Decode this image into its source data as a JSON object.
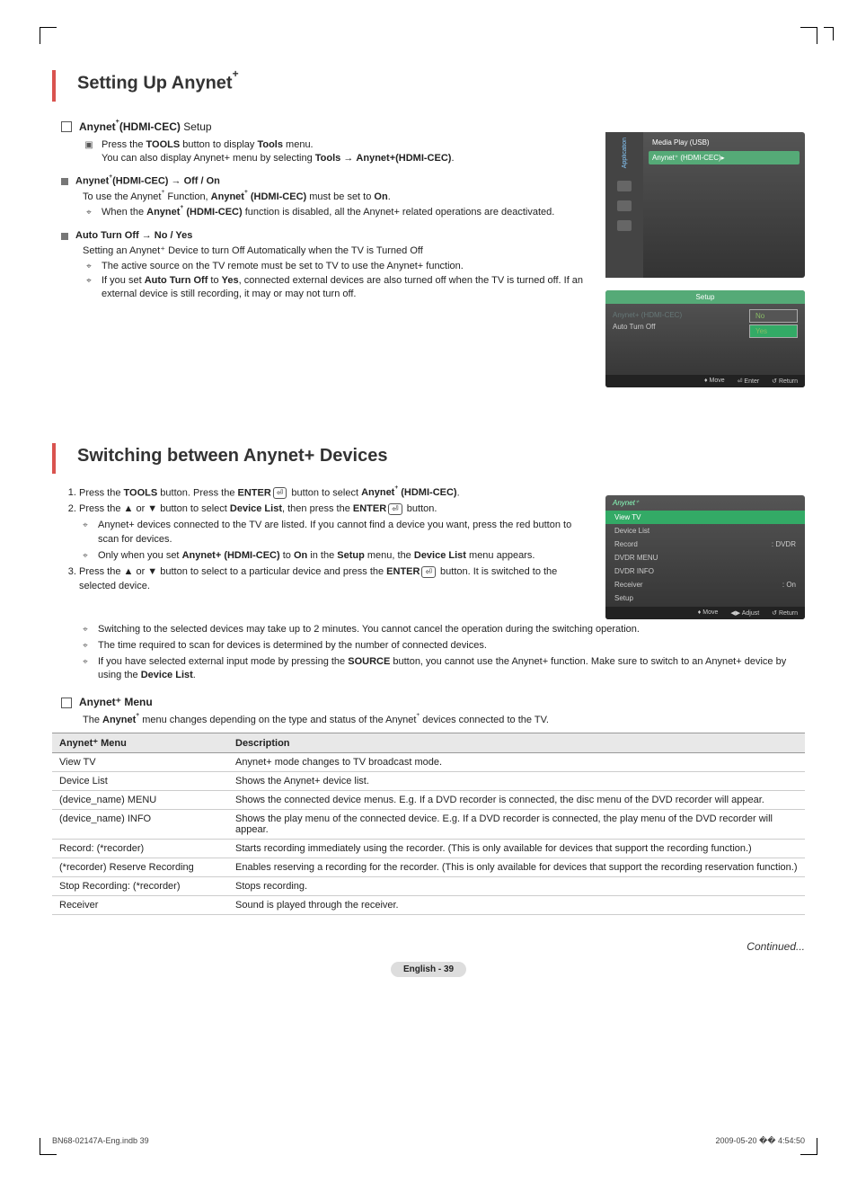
{
  "section1": {
    "title_pre": "Setting Up Anynet",
    "sub1_bold": "Anynet",
    "sub1_bold2": "(HDMI-CEC)",
    "sub1_rest": " Setup",
    "tools_line1_a": "Press the ",
    "tools_line1_b": "TOOLS",
    "tools_line1_c": " button to display ",
    "tools_line1_d": "Tools",
    "tools_line1_e": " menu.",
    "tools_line2_a": "You can also display Anynet+ menu by selecting ",
    "tools_line2_b": "Tools",
    "tools_line2_c": " → ",
    "tools_line2_d": "Anynet+(HDMI-CEC)",
    "tools_line2_e": ".",
    "b1_head_a": "Anynet",
    "b1_head_b": "(HDMI-CEC) → Off / On",
    "b1_line1_a": "To use the Anynet",
    "b1_line1_b": " Function, ",
    "b1_line1_c": "Anynet",
    "b1_line1_d": " (HDMI-CEC)",
    "b1_line1_e": " must be set to ",
    "b1_line1_f": "On",
    "b1_line1_g": ".",
    "b1_note_a": "When the ",
    "b1_note_b": "Anynet",
    "b1_note_c": " (HDMI-CEC)",
    "b1_note_d": " function is disabled, all the Anynet+ related operations are deactivated.",
    "b2_head": "Auto Turn Off → No / Yes",
    "b2_line1": "Setting an Anynet⁺ Device to turn Off Automatically when the TV is Turned Off",
    "b2_note1": "The active source on the TV remote must be set to TV to use the Anynet+ function.",
    "b2_note2_a": "If you set ",
    "b2_note2_b": "Auto Turn Off",
    "b2_note2_c": " to ",
    "b2_note2_d": "Yes",
    "b2_note2_e": ", connected external devices are also turned off when the TV is turned off. If an external device is still recording, it may or may not turn off."
  },
  "section2": {
    "title": "Switching between Anynet+ Devices",
    "s1_a": "Press the ",
    "s1_b": "TOOLS",
    "s1_c": " button. Press the ",
    "s1_d": "ENTER",
    "s1_e": " button to select ",
    "s1_f": "Anynet",
    "s1_g": " (HDMI-CEC)",
    "s1_h": ".",
    "s2_a": "Press the ▲ or ▼ button to select ",
    "s2_b": "Device List",
    "s2_c": ", then press the ",
    "s2_d": "ENTER",
    "s2_e": " button.",
    "s2n1": "Anynet+ devices connected to the TV are listed. If you cannot find a device you want, press the red button to scan for devices.",
    "s2n2_a": "Only when you set ",
    "s2n2_b": "Anynet+ (HDMI-CEC)",
    "s2n2_c": " to ",
    "s2n2_d": "On",
    "s2n2_e": " in the ",
    "s2n2_f": "Setup",
    "s2n2_g": " menu, the ",
    "s2n2_h": "Device List",
    "s2n2_i": " menu appears.",
    "s3_a": "Press the ▲ or ▼ button to select to a particular device and press the ",
    "s3_b": "ENTER",
    "s3_c": " button. It is switched to the selected device.",
    "n1": "Switching to the selected devices may take up to 2 minutes. You cannot cancel the operation during the switching operation.",
    "n2": "The time required to scan for devices is determined by the number of connected devices.",
    "n3_a": "If you have selected external input mode by pressing the ",
    "n3_b": "SOURCE",
    "n3_c": " button, you cannot use the Anynet+ function. Make sure to switch to an Anynet+ device by using the ",
    "n3_d": "Device List",
    "n3_e": ".",
    "menu_head": "Anynet⁺ Menu",
    "menu_desc_a": "The ",
    "menu_desc_b": "Anynet",
    "menu_desc_c": " menu changes depending on the type and status of the Anynet",
    "menu_desc_d": " devices connected to the TV.",
    "th1": "Anynet⁺ Menu",
    "th2": "Description",
    "rows": [
      {
        "a": "View TV",
        "b": "Anynet+ mode changes to TV broadcast mode."
      },
      {
        "a": "Device List",
        "b": "Shows the Anynet+ device list."
      },
      {
        "a": "(device_name) MENU",
        "b": "Shows the connected device menus. E.g. If a DVD recorder is connected, the disc menu of the DVD recorder will appear."
      },
      {
        "a": "(device_name) INFO",
        "b": "Shows the play menu of the connected device. E.g. If a DVD recorder is connected, the play menu of the DVD recorder will appear."
      },
      {
        "a": "Record: (*recorder)",
        "b": "Starts recording immediately using the recorder. (This is only available for devices that support the recording function.)"
      },
      {
        "a": "(*recorder) Reserve Recording",
        "b": "Enables reserving a recording for the recorder. (This is only available for devices that support the recording reservation function.)"
      },
      {
        "a": "Stop Recording: (*recorder)",
        "b": "Stops recording."
      },
      {
        "a": "Receiver",
        "b": "Sound is played through the receiver."
      }
    ],
    "continued": "Continued..."
  },
  "shots": {
    "s1": {
      "side": "Application",
      "r1": "Media Play (USB)",
      "r2": "Anynet⁺ (HDMI-CEC)▸"
    },
    "s2": {
      "title": "Setup",
      "l1": "Anynet+ (HDMI-CEC)",
      "l2": "Auto Turn Off",
      "optNo": "No",
      "optYes": "Yes",
      "f1": "♦ Move",
      "f2": "⏎ Enter",
      "f3": "↺ Return"
    },
    "s3": {
      "title": "Anynet⁺",
      "lines": [
        {
          "a": "View TV",
          "b": ""
        },
        {
          "a": "Device List",
          "b": ""
        },
        {
          "a": "Record",
          "b": ": DVDR"
        },
        {
          "a": "DVDR MENU",
          "b": ""
        },
        {
          "a": "DVDR INFO",
          "b": ""
        },
        {
          "a": "Receiver",
          "b": ": On"
        },
        {
          "a": "Setup",
          "b": ""
        }
      ],
      "f1": "♦ Move",
      "f2": "◀▶ Adjust",
      "f3": "↺ Return"
    }
  },
  "footer": {
    "page": "English - 39",
    "left": "BN68-02147A-Eng.indb   39",
    "right": "2009-05-20   �� 4:54:50"
  }
}
